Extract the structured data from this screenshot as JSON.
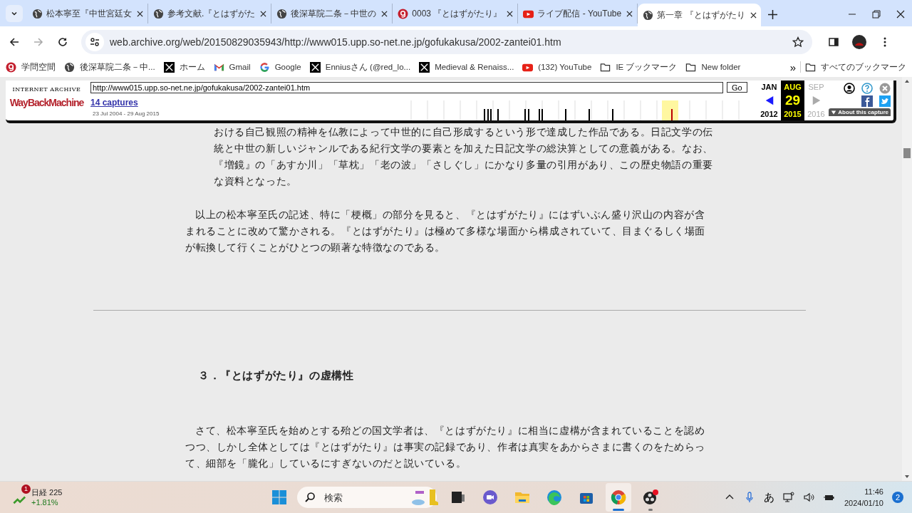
{
  "browser": {
    "tabs": [
      {
        "title": "松本寧至『中世宮廷女",
        "kind": "globe",
        "selected": false
      },
      {
        "title": "参考文献.『とはずがた",
        "kind": "globe",
        "selected": false
      },
      {
        "title": "後深草院二条－中世の",
        "kind": "globe",
        "selected": false
      },
      {
        "title": "0003 『とはずがたり』",
        "kind": "badge",
        "selected": false
      },
      {
        "title": "ライブ配信 - YouTube",
        "kind": "video",
        "selected": false
      },
      {
        "title": "第一章 『とはずがたり",
        "kind": "globe",
        "selected": true
      }
    ],
    "url": "web.archive.org/web/20150829035943/http://www015.upp.so-net.ne.jp/gofukakusa/2002-zantei01.htm",
    "bookmarks": [
      {
        "label": "学問空間",
        "kind": "badge"
      },
      {
        "label": "後深草院二条－中...",
        "kind": "globe"
      },
      {
        "label": "ホーム",
        "kind": "x"
      },
      {
        "label": "Gmail",
        "kind": "mail"
      },
      {
        "label": "Google",
        "kind": "g"
      },
      {
        "label": "Enniusさん (@red_lo...",
        "kind": "x"
      },
      {
        "label": "Medieval & Renaiss...",
        "kind": "x"
      },
      {
        "label": "(132) YouTube",
        "kind": "video"
      },
      {
        "label": "IE ブックマーク",
        "kind": "folder"
      },
      {
        "label": "New folder",
        "kind": "folder"
      }
    ],
    "more": "»",
    "all_bookmarks": "すべてのブックマーク"
  },
  "wayback": {
    "logo_top": "INTERNET ARCHIVE",
    "logo": "WayBackMachine",
    "url": "http://www015.upp.so-net.ne.jp/gofukakusa/2002-zantei01.htm",
    "go": "Go",
    "captures": "14 captures",
    "range": "23 Jul 2004 - 29 Aug 2015",
    "dates": [
      {
        "month": "JAN",
        "year": "2012",
        "selected": false,
        "disabled": false
      },
      {
        "month": "AUG",
        "day": "29",
        "year": "2015",
        "selected": true,
        "disabled": false
      },
      {
        "month": "SEP",
        "year": "2016",
        "selected": false,
        "disabled": true
      }
    ],
    "about": "About this capture"
  },
  "article": [
    {
      "kind": "quote",
      "text": "おける自己観照の精神を仏教によって中世的に自己形成するという形で達成した作品である。日記文学の伝統と中世の新しいジャンルである紀行文学の要素とを加えた日記文学の総決算としての意義がある。なお、『増鏡』の「あすか川」「草枕」「老の波」「さしぐし」にかなり多量の引用があり、この歴史物語の重要な資料となった。"
    },
    {
      "kind": "para",
      "text": "以上の松本寧至氏の記述、特に「梗概」の部分を見ると、『とはずがたり』にはずいぶん盛り沢山の内容が含まれることに改めて驚かされる。『とはずがたり』は極めて多様な場面から構成されていて、目まぐるしく場面が転換して行くことがひとつの顕著な特徴なのである。"
    },
    {
      "kind": "rule"
    },
    {
      "kind": "heading",
      "text": "３．『とはずがたり』の虚構性"
    },
    {
      "kind": "para",
      "text": "さて、松本寧至氏を始めとする殆どの国文学者は、『とはずがたり』に相当に虚構が含まれていることを認めつつ、しかし全体としては『とはずがたり』は事実の記録であり、作者は真実をあからさまに書くのをためらって、細部を「朧化」しているにすぎないのだと説いている。"
    }
  ],
  "taskbar": {
    "widget": {
      "label": "日経 225",
      "change": "+1.81%",
      "badge": "1"
    },
    "search_placeholder": "検索",
    "apps": [
      {
        "kind": "taskview",
        "running": false,
        "selected": false
      },
      {
        "kind": "meet",
        "running": false,
        "selected": false
      },
      {
        "kind": "folder",
        "running": false,
        "selected": false
      },
      {
        "kind": "edge",
        "running": false,
        "selected": false
      },
      {
        "kind": "store",
        "running": false,
        "selected": false
      },
      {
        "kind": "chrome",
        "running": true,
        "selected": true
      },
      {
        "kind": "obs",
        "running": true,
        "selected": false
      }
    ],
    "ime": "あ",
    "time": "11:46",
    "date": "2024/01/10",
    "notifications": "2"
  }
}
